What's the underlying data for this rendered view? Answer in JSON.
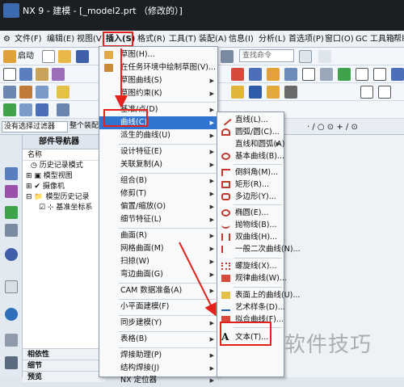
{
  "window": {
    "title": "NX 9 - 建模 - [_model2.prt （修改的）]"
  },
  "menubar": {
    "items": [
      "文件(F)",
      "编辑(E)",
      "视图(V)",
      "插入(S)",
      "格式(R)",
      "工具(T)",
      "装配(A)",
      "信息(I)",
      "分析(L)",
      "首选项(P)",
      "窗口(O)",
      "GC 工具箱",
      "帮助"
    ]
  },
  "toolbar": {
    "start_label": "启动",
    "search_placeholder": "查找命令"
  },
  "filterbar": {
    "selection_filter": "没有选择过滤器",
    "assembly_scope": "整个装配"
  },
  "navigator": {
    "title": "部件导航器",
    "column_name": "名称",
    "nodes": [
      "历史记录模式",
      "模型视图",
      "摄像机",
      "模型历史记录",
      "基准坐标系"
    ],
    "footer": [
      "相依性",
      "细节",
      "预览"
    ]
  },
  "insert_menu": {
    "items": [
      "草图(H)...",
      "在任务环境中绘制草图(V)...",
      "草图曲线(S)",
      "草图约束(K)",
      "基准/点(D)",
      "曲线(C)",
      "派生的曲线(U)",
      "设计特征(E)",
      "关联复制(A)",
      "组合(B)",
      "修剪(T)",
      "偏置/缩放(O)",
      "细节特征(L)",
      "曲面(R)",
      "网格曲面(M)",
      "扫掠(W)",
      "弯边曲面(G)",
      "CAM 数据准备(A)",
      "小平面建模(F)",
      "同步建模(Y)",
      "表格(B)",
      "焊接助理(P)",
      "结构焊接(J)",
      "NX 定位器"
    ]
  },
  "curve_menu": {
    "items": [
      "直线(L)...",
      "圆弧/圆(C)...",
      "直线和圆弧(A)",
      "基本曲线(B)...",
      "倒斜角(M)...",
      "矩形(R)...",
      "多边形(Y)...",
      "椭圆(E)...",
      "抛物线(B)...",
      "双曲线(H)...",
      "一般二次曲线(N)...",
      "螺旋线(X)...",
      "规律曲线(W)...",
      "表面上的曲线(U)...",
      "艺术样条(D)...",
      "拟合曲线(F)...",
      "文本(T)..."
    ]
  },
  "watermark": "软件技巧"
}
